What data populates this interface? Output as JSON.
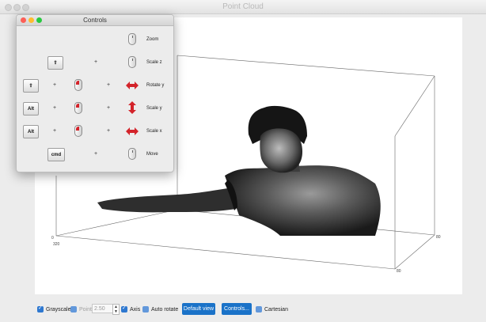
{
  "window": {
    "title": "Point Cloud"
  },
  "controls_window": {
    "title": "Controls",
    "rows": [
      {
        "action": "Zoom",
        "keys": [],
        "mouse": "scroll"
      },
      {
        "action": "Scale z",
        "keys": [
          "shift"
        ],
        "mouse": "scroll"
      },
      {
        "action": "Rotate y",
        "keys": [
          "shift"
        ],
        "mouse": "left-drag",
        "arrow": "horizontal"
      },
      {
        "action": "Scale y",
        "keys": [
          "Alt"
        ],
        "mouse": "left-drag",
        "arrow": "vertical"
      },
      {
        "action": "Scale x",
        "keys": [
          "Alt"
        ],
        "mouse": "left-drag",
        "arrow": "horizontal"
      },
      {
        "action": "Move",
        "keys": [
          "cmd"
        ],
        "mouse": "scroll"
      }
    ],
    "plus_sign": "+",
    "key_labels": {
      "shift": "⇧",
      "alt": "Alt",
      "cmd": "cmd"
    },
    "colors": {
      "close": "#fd5f57",
      "minimize": "#febc2e",
      "zoom": "#28c840",
      "arrow": "#d3232a"
    }
  },
  "plot": {
    "tick_labels": {
      "origin_y": "0",
      "origin_x": "320",
      "right_top": "80",
      "right_bottom": "80"
    }
  },
  "toolbar": {
    "grayscale": {
      "label": "Grayscale",
      "checked": true
    },
    "points": {
      "label": "Points",
      "checked": false,
      "value": "2.50"
    },
    "axis": {
      "label": "Axis",
      "checked": true
    },
    "auto_rotate": {
      "label": "Auto rotate",
      "checked": false
    },
    "default_view_label": "Default view",
    "controls_label": "Controls...",
    "cartesian": {
      "label": "Cartesian",
      "checked": false
    },
    "accent_color": "#1a72c8"
  }
}
